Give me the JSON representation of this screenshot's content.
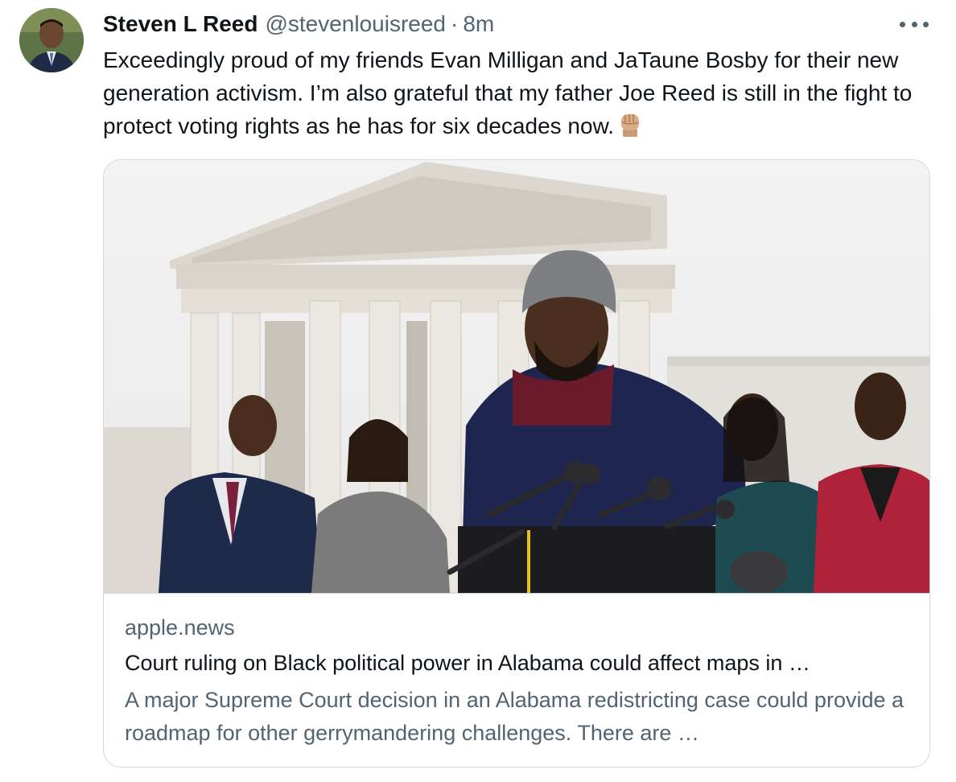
{
  "tweet": {
    "author": {
      "display_name": "Steven L Reed",
      "handle": "@stevenlouisreed",
      "separator": "·",
      "time": "8m",
      "avatar_icon": "profile-photo"
    },
    "more_icon": "ellipsis-icon",
    "text": "Exceedingly proud of my friends Evan Milligan and JaTaune Bosby for their new generation activism. I’m also grateful that my father Joe Reed is still in the fight to protect voting rights as he has for six decades now.",
    "emoji": "raised-fist-medium-light-skin-tone",
    "card": {
      "domain": "apple.news",
      "title": "Court ruling on Black political power in Alabama could affect maps in …",
      "description": "A major Supreme Court decision in an Alabama redistricting case could provide a roadmap for other gerrymandering challenges. There are …"
    }
  },
  "colors": {
    "text_primary": "#0f1419",
    "text_secondary": "#536471",
    "card_border": "#cfd9de",
    "background": "#ffffff"
  }
}
